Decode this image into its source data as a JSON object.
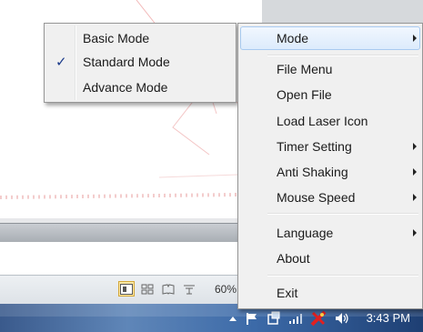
{
  "submenu": {
    "items": [
      {
        "label": "Basic Mode",
        "checked": false
      },
      {
        "label": "Standard Mode",
        "checked": true
      },
      {
        "label": "Advance Mode",
        "checked": false
      }
    ],
    "check_glyph": "✓"
  },
  "menu": {
    "items": [
      {
        "label": "Mode",
        "has_submenu": true
      },
      {
        "label": "File Menu",
        "has_submenu": false
      },
      {
        "label": "Open File",
        "has_submenu": false
      },
      {
        "label": "Load Laser Icon",
        "has_submenu": false
      },
      {
        "label": "Timer Setting",
        "has_submenu": true
      },
      {
        "label": "Anti Shaking",
        "has_submenu": true
      },
      {
        "label": "Mouse Speed",
        "has_submenu": true
      },
      {
        "label": "Language",
        "has_submenu": true
      },
      {
        "label": "About",
        "has_submenu": false
      },
      {
        "label": "Exit",
        "has_submenu": false
      }
    ]
  },
  "statusbar": {
    "zoom": "60%",
    "view_icons": [
      "print-layout-icon",
      "web-layout-icon",
      "reading-layout-icon",
      "outline-icon"
    ]
  },
  "taskbar": {
    "clock": "3:43 PM",
    "tray_icons": [
      "show-hidden-icons-arrow",
      "action-center-flag-icon",
      "app-tray-icon",
      "network-signal-icon",
      "laser-pointer-tray-icon",
      "volume-icon"
    ]
  },
  "colors": {
    "menu_bg": "#f0f0f0",
    "highlight": "#dcebfc",
    "taskbar": "#3c6aa8"
  }
}
